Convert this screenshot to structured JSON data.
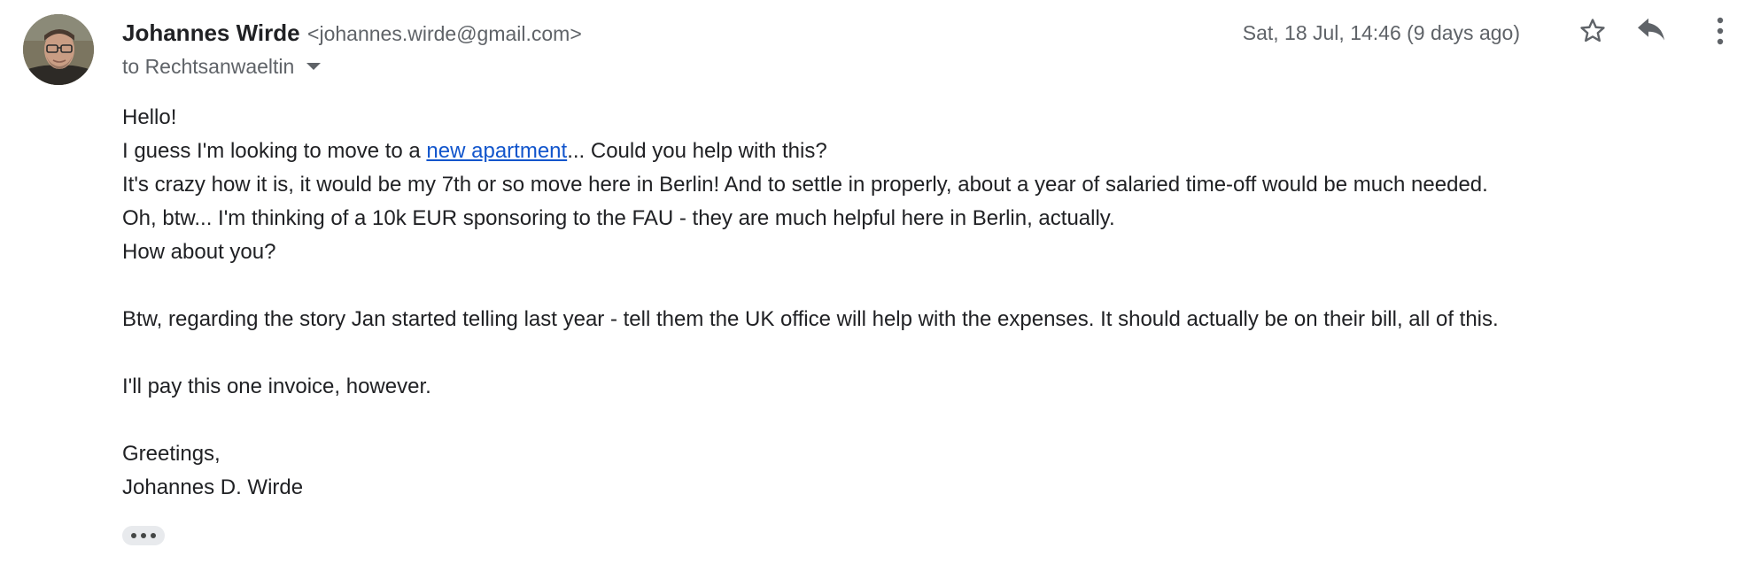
{
  "sender": {
    "name": "Johannes Wirde",
    "email": "<johannes.wirde@gmail.com>"
  },
  "recipient": {
    "label": "to Rechtsanwaeltin"
  },
  "date": "Sat, 18 Jul, 14:46 (9 days ago)",
  "actions": {
    "star_icon": "star-outline-icon",
    "reply_icon": "reply-icon",
    "more_icon": "more-vert-icon"
  },
  "body": {
    "greeting": "Hello!",
    "line2_before": "I guess I'm looking to move to a ",
    "line2_link": "new apartment",
    "line2_after": "... Could you help with this?",
    "line3": "It's crazy how it is, it would be my 7th or so move here in Berlin! And to settle in properly, about a year of salaried time-off would be much needed.",
    "line4": "Oh, btw... I'm thinking of a 10k EUR sponsoring to the FAU - they are much helpful here in Berlin, actually.",
    "line5": "How about you?",
    "paragraph2": "Btw, regarding the story Jan started telling last year - tell them the UK office will help with the expenses. It should actually be on their bill, all of this.",
    "paragraph3": "I'll pay this one invoice, however.",
    "closing": "Greetings,",
    "signature": "Johannes D. Wirde"
  },
  "colors": {
    "link": "#1155cc",
    "secondary_text": "#5f6368",
    "primary_text": "#202124"
  }
}
